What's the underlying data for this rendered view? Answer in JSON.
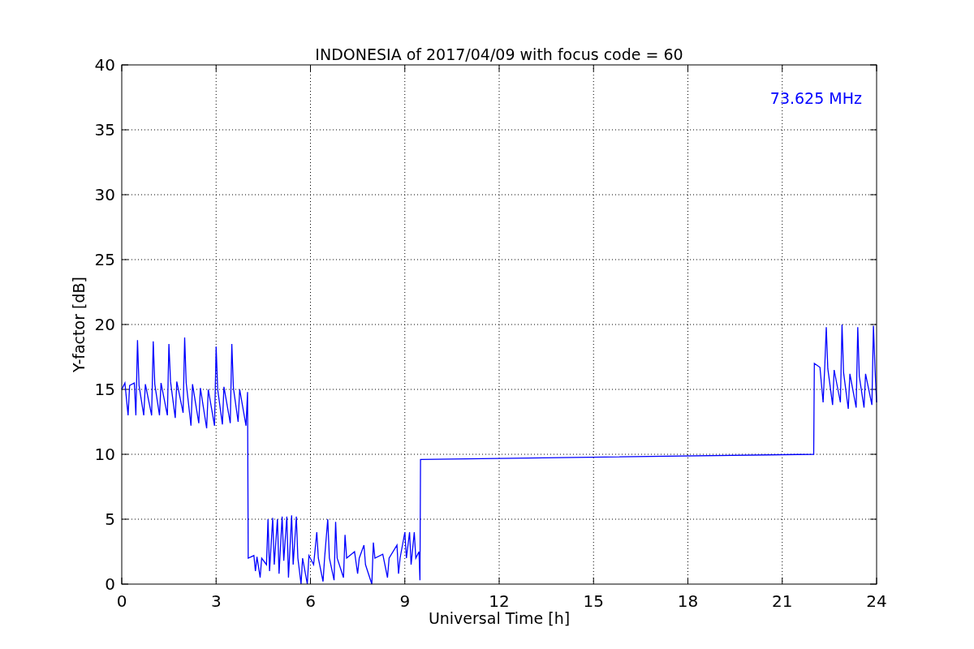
{
  "figure": {
    "chart_data": {
      "type": "line",
      "title": "INDONESIA of 2017/04/09 with focus code = 60",
      "xlabel": "Universal Time [h]",
      "ylabel": "Y-factor [dB]",
      "x": [
        0,
        0.1,
        0.2,
        0.25,
        0.4,
        0.45,
        0.5,
        0.55,
        0.7,
        0.75,
        0.95,
        1.0,
        1.05,
        1.2,
        1.25,
        1.45,
        1.5,
        1.55,
        1.7,
        1.75,
        1.95,
        2.0,
        2.05,
        2.2,
        2.25,
        2.45,
        2.5,
        2.7,
        2.75,
        2.95,
        3.0,
        3.05,
        3.2,
        3.25,
        3.45,
        3.5,
        3.55,
        3.7,
        3.75,
        3.95,
        4.0,
        4.02,
        4.2,
        4.25,
        4.3,
        4.4,
        4.45,
        4.6,
        4.65,
        4.7,
        4.8,
        4.85,
        4.95,
        5.0,
        5.1,
        5.15,
        5.25,
        5.3,
        5.4,
        5.45,
        5.55,
        5.6,
        5.7,
        5.75,
        5.9,
        5.95,
        6.1,
        6.2,
        6.25,
        6.4,
        6.45,
        6.55,
        6.6,
        6.75,
        6.8,
        6.85,
        7.05,
        7.1,
        7.15,
        7.4,
        7.5,
        7.55,
        7.7,
        7.75,
        7.95,
        8.0,
        8.05,
        8.3,
        8.45,
        8.5,
        8.75,
        8.8,
        8.85,
        9.0,
        9.05,
        9.15,
        9.2,
        9.3,
        9.35,
        9.45,
        9.48,
        9.5,
        22.0,
        22.02,
        22.2,
        22.3,
        22.35,
        22.4,
        22.45,
        22.6,
        22.65,
        22.85,
        22.9,
        22.95,
        23.1,
        23.15,
        23.35,
        23.4,
        23.45,
        23.6,
        23.65,
        23.85,
        23.9,
        23.95,
        24.0
      ],
      "series": [
        {
          "color": "#0000ff",
          "values": [
            15,
            15.5,
            13,
            15.3,
            15.5,
            13,
            18.8,
            15.3,
            13,
            15.4,
            13,
            18.7,
            15.4,
            13,
            15.5,
            13,
            18.5,
            15.6,
            12.8,
            15.6,
            13.2,
            19,
            15.5,
            12.2,
            15.4,
            12.4,
            15.1,
            12,
            15,
            12.2,
            18.3,
            15,
            12.3,
            15.2,
            12.4,
            18.5,
            15.1,
            12.5,
            15,
            12.2,
            14.8,
            2,
            2.2,
            1,
            2.1,
            0.5,
            2,
            1.5,
            5,
            1,
            5.1,
            1.5,
            5,
            0.8,
            5.2,
            1.8,
            5.2,
            0.5,
            5.3,
            1.5,
            5.2,
            2,
            0,
            2,
            0,
            2.2,
            1.5,
            4,
            2,
            0.2,
            2,
            5,
            2,
            0.3,
            4.8,
            2,
            0.5,
            3.8,
            2,
            2.5,
            0.8,
            2,
            3,
            1.5,
            0,
            3.2,
            2,
            2.3,
            0.5,
            2,
            3,
            0.8,
            2,
            4,
            2,
            4,
            1.5,
            4,
            2,
            2.5,
            0.3,
            9.6,
            10,
            17,
            16.7,
            14,
            16.7,
            19.8,
            16.6,
            13.8,
            16.5,
            14,
            20,
            16.3,
            13.5,
            16.2,
            13.6,
            19.8,
            16,
            13.6,
            16.2,
            13.8,
            19.9,
            16.5,
            14
          ]
        }
      ],
      "xlim": [
        0,
        24
      ],
      "ylim": [
        0,
        40
      ],
      "xticks": [
        0,
        3,
        6,
        9,
        12,
        15,
        18,
        21,
        24
      ],
      "yticks": [
        0,
        5,
        10,
        15,
        20,
        25,
        30,
        35,
        40
      ],
      "grid": true,
      "annotations": [
        {
          "text": "73.625 MHz"
        }
      ]
    }
  }
}
